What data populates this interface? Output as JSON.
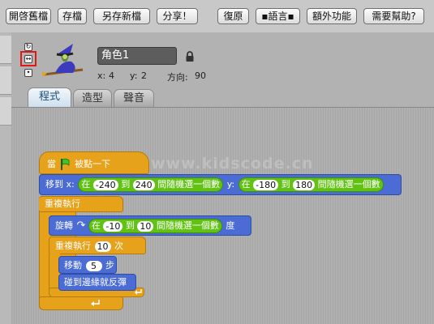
{
  "menu": {
    "open": "開啓舊檔",
    "save": "存檔",
    "save_as": "另存新檔",
    "share": "分享！",
    "restore": "復原",
    "language": "▪語言▪",
    "extras": "額外功能",
    "help": "需要幫助?"
  },
  "sprite": {
    "name": "角色1",
    "x_label": "x:",
    "x_value": "4",
    "y_label": "y:",
    "y_value": "2",
    "dir_label": "方向:",
    "dir_value": "90",
    "rotate_glyph": "↻",
    "flip_glyph": "↔",
    "none_glyph": "•"
  },
  "tabs": [
    {
      "label": "程式"
    },
    {
      "label": "造型"
    },
    {
      "label": "聲音"
    }
  ],
  "watermark": "www.kidscode.cn",
  "script": {
    "hat": {
      "pre": "當",
      "post": "被點一下"
    },
    "goto": {
      "label": "移到 x:",
      "r1": {
        "a": "在",
        "min": "-240",
        "to": "到",
        "max": "240",
        "rand": "間隨機選一個數"
      },
      "y_label": "y:",
      "r2": {
        "a": "在",
        "min": "-180",
        "to": "到",
        "max": "180",
        "rand": "間隨機選一個數"
      }
    },
    "forever": "重複執行",
    "turn": {
      "label": "旋轉",
      "r": {
        "a": "在",
        "min": "-10",
        "to": "到",
        "max": "10",
        "rand": "間隨機選一個數"
      },
      "unit": "度"
    },
    "repeat": {
      "label": "重複執行",
      "count": "10",
      "unit": "次"
    },
    "move": {
      "label": "移動",
      "steps": "5",
      "unit": "步"
    },
    "bounce": "碰到邊緣就反彈"
  },
  "colors": {
    "control": "#e6a21a",
    "motion": "#4a6cd4",
    "operators": "#62c213",
    "selection": "#e01818"
  }
}
